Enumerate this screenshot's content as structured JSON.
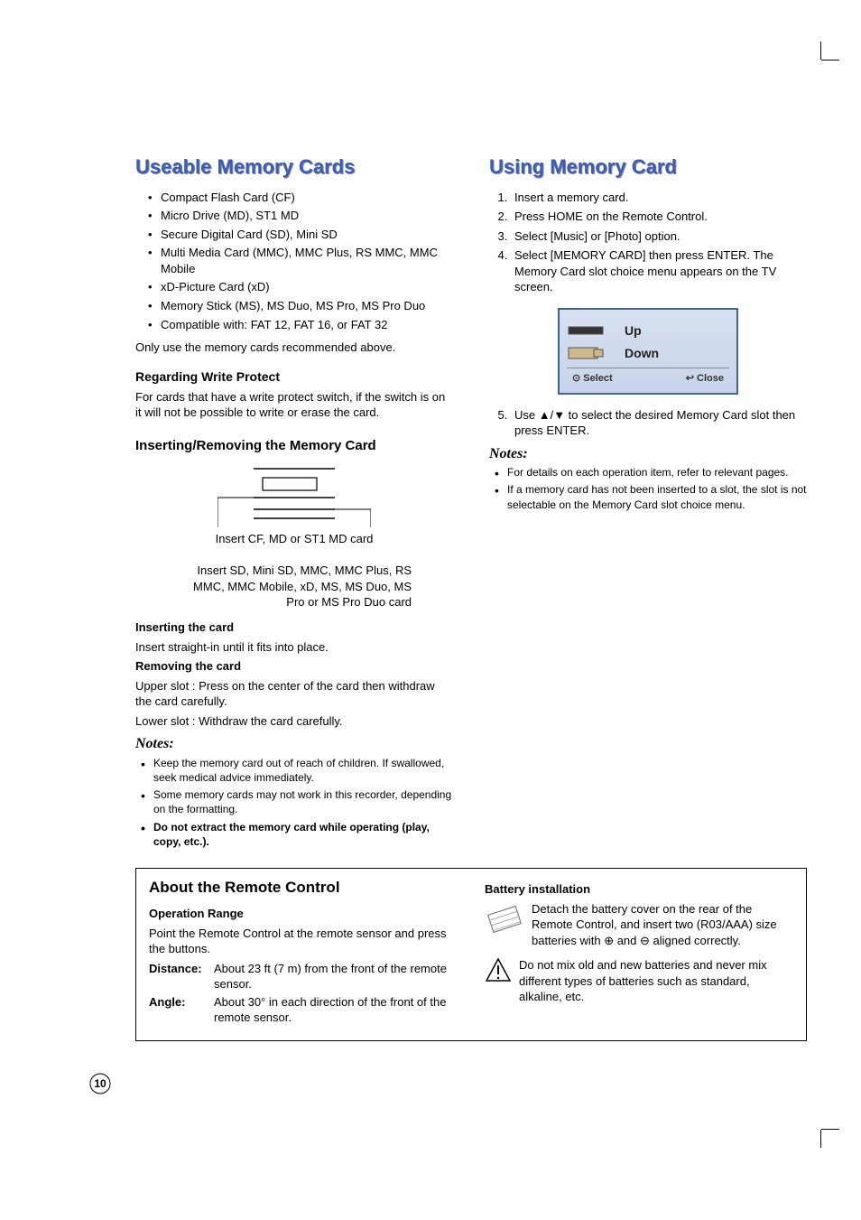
{
  "left": {
    "title": "Useable Memory Cards",
    "bullets": [
      "Compact Flash Card (CF)",
      "Micro Drive (MD), ST1 MD",
      "Secure Digital Card (SD), Mini SD",
      "Multi Media Card (MMC), MMC Plus, RS MMC, MMC Mobile",
      "xD-Picture Card (xD)",
      "Memory Stick (MS), MS Duo, MS Pro, MS Pro Duo",
      "Compatible with: FAT 12, FAT 16, or FAT 32"
    ],
    "only_use": "Only use the memory cards recommended above.",
    "wp_title": "Regarding Write Protect",
    "wp_text": "For cards that have a write protect switch, if the switch is on it will not be possible to write or erase the card.",
    "ir_title": "Inserting/Removing the Memory Card",
    "slot_upper_caption": "Insert CF, MD or ST1 MD card",
    "slot_lower_caption": "Insert SD, Mini SD, MMC, MMC Plus, RS MMC, MMC Mobile, xD, MS, MS Duo, MS Pro or MS Pro Duo card",
    "insert_title": "Inserting the card",
    "insert_text": "Insert straight-in until it fits into place.",
    "remove_title": "Removing the card",
    "remove_upper": "Upper slot : Press on the center of the card then withdraw the card carefully.",
    "remove_lower": "Lower slot : Withdraw the card carefully.",
    "notes_title": "Notes:",
    "notes": [
      "Keep the memory card out of reach of children. If swallowed, seek medical advice immediately.",
      "Some memory cards may not work in this recorder, depending on the formatting.",
      "Do not extract the memory card while operating (play, copy, etc.)."
    ]
  },
  "right": {
    "title": "Using Memory Card",
    "steps": [
      "Insert a memory card.",
      "Press HOME on the Remote Control.",
      "Select [Music] or [Photo] option.",
      "Select [MEMORY CARD] then press ENTER. The Memory Card slot choice menu appears on the TV screen."
    ],
    "menu": {
      "up": "Up",
      "down": "Down",
      "select": "Select",
      "close": "Close"
    },
    "step5": "Use ▲/▼ to select the desired Memory Card slot then press ENTER.",
    "notes_title": "Notes:",
    "notes": [
      "For details on each operation item, refer to relevant pages.",
      "If a memory card has not been inserted to a slot, the slot is not selectable on the Memory Card slot choice menu."
    ]
  },
  "remote": {
    "title": "About the Remote Control",
    "op_range_title": "Operation Range",
    "op_range_text": "Point the Remote Control at the remote sensor and press the buttons.",
    "distance_label": "Distance:",
    "distance_text": "About 23 ft (7 m) from the front of the remote sensor.",
    "angle_label": "Angle:",
    "angle_text": "About 30° in each direction of the front of the remote sensor.",
    "batt_title": "Battery installation",
    "batt_text": "Detach the battery cover on the rear of the Remote Control, and insert two (R03/AAA) size batteries with ⊕ and ⊖ aligned correctly.",
    "warn_text": "Do not mix old and new batteries and never mix different types of batteries such as standard, alkaline, etc."
  },
  "page_number": "10"
}
